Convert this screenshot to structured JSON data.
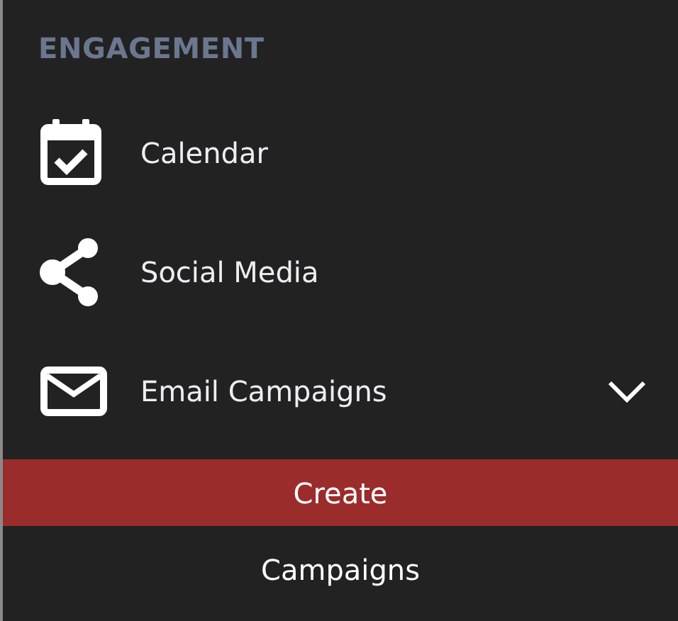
{
  "section": {
    "title": "ENGAGEMENT"
  },
  "items": [
    {
      "label": "Calendar"
    },
    {
      "label": "Social Media"
    },
    {
      "label": "Email Campaigns",
      "expanded": true,
      "children": [
        {
          "label": "Create",
          "selected": true
        },
        {
          "label": "Campaigns",
          "selected": false
        }
      ]
    }
  ]
}
